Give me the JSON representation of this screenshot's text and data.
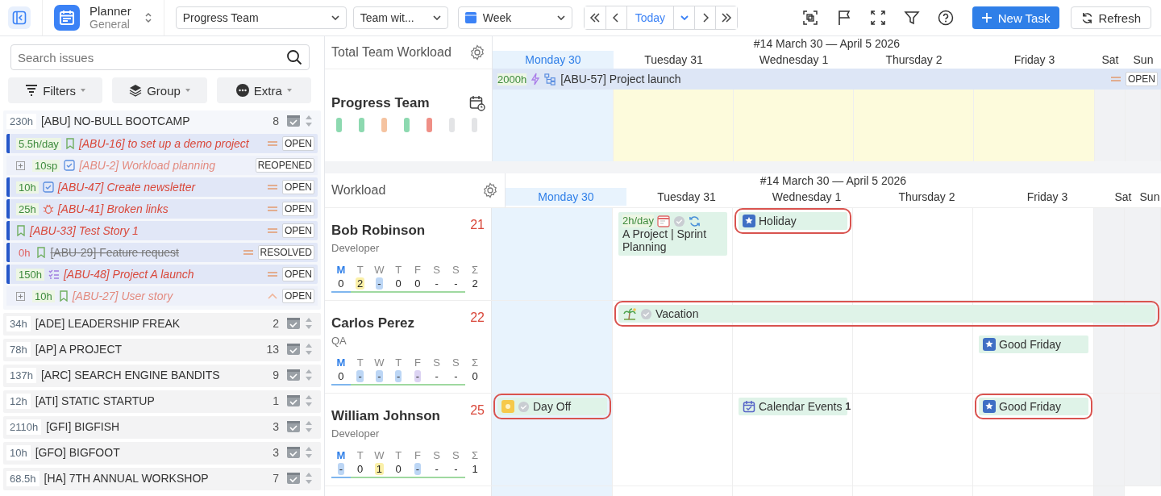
{
  "topbar": {
    "app_title": "Planner",
    "app_subtitle": "General",
    "selects": [
      {
        "kind": "plain",
        "value": "Progress Team"
      },
      {
        "kind": "plain",
        "value": "Team wit..."
      },
      {
        "kind": "calendar",
        "value": "Week"
      }
    ],
    "today_button": "Today",
    "new_task": "New Task",
    "refresh": "Refresh"
  },
  "sidebar": {
    "search": {
      "placeholder": "Search issues"
    },
    "buttons": [
      {
        "kind": "filter",
        "label": "Filters"
      },
      {
        "kind": "layers",
        "label": "Group"
      },
      {
        "kind": "more",
        "label": "Extra"
      }
    ],
    "groups": [
      {
        "hours": "230h",
        "title": "[ABU] NO-BULL BOOTCAMP",
        "count": "8",
        "issues": [
          {
            "estimate": "5.5h/day",
            "kind": "story",
            "title": "[ABU-16] to set up a demo project",
            "priority": {
              "kind": "medium"
            },
            "status": "OPEN",
            "expandable": false,
            "resolved": false,
            "alert": false
          },
          {
            "estimate": "10sp",
            "kind": "task",
            "title": "[ABU-2] Workload planning",
            "status": "REOPENED",
            "expandable": true,
            "resolved": false,
            "alert": false
          },
          {
            "estimate": "10h",
            "kind": "task",
            "title": "[ABU-47] Create newsletter",
            "priority": {
              "kind": "medium"
            },
            "status": "OPEN",
            "expandable": false,
            "resolved": false,
            "alert": false
          },
          {
            "estimate": "25h",
            "kind": "bug",
            "title": "[ABU-41] Broken links",
            "priority": {
              "kind": "medium"
            },
            "status": "OPEN",
            "expandable": false,
            "resolved": false,
            "alert": false
          },
          {
            "kind": "story",
            "title": "[ABU-33] Test Story 1",
            "priority": {
              "kind": "medium"
            },
            "status": "OPEN",
            "expandable": false,
            "resolved": false
          },
          {
            "estimate": "0h",
            "kind": "story",
            "title": "[ABU-29] Feature request",
            "priority": {
              "kind": "medium"
            },
            "status": "RESOLVED",
            "expandable": false,
            "resolved": true,
            "alert": true
          },
          {
            "estimate": "150h",
            "kind": "epic",
            "title": "[ABU-48] Project A launch",
            "priority": {
              "kind": "medium"
            },
            "status": "OPEN",
            "expandable": false,
            "resolved": false,
            "alert": false
          },
          {
            "estimate": "10h",
            "kind": "story",
            "title": "[ABU-27] User story",
            "priority": {
              "kind": "high"
            },
            "status": "OPEN",
            "expandable": true,
            "resolved": false,
            "alert": false
          }
        ]
      },
      {
        "hours": "34h",
        "title": "[ADE] LEADERSHIP FREAK",
        "count": "2"
      },
      {
        "hours": "78h",
        "title": "[AP] A PROJECT",
        "count": "13"
      },
      {
        "hours": "137h",
        "title": "[ARC] SEARCH ENGINE BANDITS",
        "count": "9"
      },
      {
        "hours": "12h",
        "title": "[ATI] STATIC STARTUP",
        "count": "1"
      },
      {
        "hours": "2110h",
        "title": "[GFI] BIGFISH",
        "count": "3"
      },
      {
        "hours": "10h",
        "title": "[GFO] BIGFOOT",
        "count": "3"
      },
      {
        "hours": "68.5h",
        "title": "[HA] 7TH ANNUAL WORKSHOP",
        "count": "7"
      }
    ]
  },
  "team": {
    "title": "Total Team Workload",
    "team_name": "Progress Team",
    "stripes": [
      {
        "color": "#8dd9b0"
      },
      {
        "color": "#8dd9b0"
      },
      {
        "color": "#f5c3a0"
      },
      {
        "color": "#8dd9b0"
      },
      {
        "color": "#ef8f86"
      },
      {
        "color": "#e3e4e6"
      },
      {
        "color": "#e3e4e6"
      }
    ],
    "calendar": {
      "week": "#14 March 30 — April 5 2026",
      "days": [
        {
          "label": "Monday 30",
          "selected": true,
          "weekend": false
        },
        {
          "label": "Tuesday 31",
          "selected": false,
          "weekend": false
        },
        {
          "label": "Wednesday 1",
          "selected": false,
          "weekend": false
        },
        {
          "label": "Thursday 2",
          "selected": false,
          "weekend": false
        },
        {
          "label": "Friday 3",
          "selected": false,
          "weekend": false
        },
        {
          "label": "Sat",
          "selected": false,
          "weekend": true
        },
        {
          "label": "Sun",
          "selected": false,
          "weekend": true
        }
      ]
    },
    "task": {
      "estimate": "2000h",
      "title": "[ABU-57] Project launch",
      "priority": {
        "kind": "medium"
      },
      "status": "OPEN"
    }
  },
  "workload": {
    "title": "Workload",
    "calendar": {
      "week": "#14 March 30 — April 5 2026",
      "days": [
        {
          "label": "Monday 30",
          "selected": true,
          "weekend": false
        },
        {
          "label": "Tuesday 31",
          "selected": false,
          "weekend": false
        },
        {
          "label": "Wednesday 1",
          "selected": false,
          "weekend": false
        },
        {
          "label": "Thursday 2",
          "selected": false,
          "weekend": false
        },
        {
          "label": "Friday 3",
          "selected": false,
          "weekend": false
        },
        {
          "label": "Sat",
          "selected": false,
          "weekend": true
        },
        {
          "label": "Sun",
          "selected": false,
          "weekend": true
        }
      ]
    },
    "people": [
      {
        "name": "Bob Robinson",
        "role": "Developer",
        "count": "21",
        "days": [
          {
            "letter": "M",
            "value": "0"
          },
          {
            "letter": "T",
            "value": "2",
            "color": "#fbf0a8"
          },
          {
            "letter": "W",
            "value": "-",
            "color": "#bcd6f5"
          },
          {
            "letter": "T",
            "value": "0"
          },
          {
            "letter": "F",
            "value": "0"
          },
          {
            "letter": "S",
            "value": "-"
          },
          {
            "letter": "S",
            "value": "-"
          }
        ],
        "sum": {
          "letter": "Σ",
          "value": "2"
        },
        "events": [
          {
            "kind": "task",
            "estimate": "2h/day",
            "title": "A Project | Sprint Planning",
            "highlighted": false
          },
          {
            "kind": "holiday",
            "title": "Holiday",
            "highlighted": true
          }
        ]
      },
      {
        "name": "Carlos Perez",
        "role": "QA",
        "count": "22",
        "days": [
          {
            "letter": "M",
            "value": "0"
          },
          {
            "letter": "T",
            "value": "-",
            "color": "#bcd6f5"
          },
          {
            "letter": "W",
            "value": "-",
            "color": "#bcd6f5"
          },
          {
            "letter": "T",
            "value": "-",
            "color": "#bcd6f5"
          },
          {
            "letter": "F",
            "value": "-",
            "color": "#dcd3f3"
          },
          {
            "letter": "S",
            "value": "-"
          },
          {
            "letter": "S",
            "value": "-"
          }
        ],
        "sum": {
          "letter": "Σ",
          "value": "0"
        },
        "events": [
          {
            "kind": "vacation",
            "title": "Vacation",
            "highlighted": true
          },
          {
            "kind": "holiday",
            "title": "Good Friday",
            "highlighted": false
          }
        ]
      },
      {
        "name": "William Johnson",
        "role": "Developer",
        "count": "25",
        "days": [
          {
            "letter": "M",
            "value": "-",
            "color": "#bcd6f5"
          },
          {
            "letter": "T",
            "value": "0"
          },
          {
            "letter": "W",
            "value": "1",
            "color": "#fbf0a8"
          },
          {
            "letter": "T",
            "value": "0"
          },
          {
            "letter": "F",
            "value": "-",
            "color": "#bcd6f5"
          },
          {
            "letter": "S",
            "value": "-"
          },
          {
            "letter": "S",
            "value": "-"
          }
        ],
        "sum": {
          "letter": "Σ",
          "value": "1"
        },
        "events": [
          {
            "kind": "dayoff",
            "title": "Day Off",
            "highlighted": true
          },
          {
            "kind": "calendar",
            "title": "Calendar Events",
            "count": "1",
            "highlighted": false
          },
          {
            "kind": "holiday",
            "title": "Good Friday",
            "highlighted": true
          }
        ]
      }
    ]
  }
}
